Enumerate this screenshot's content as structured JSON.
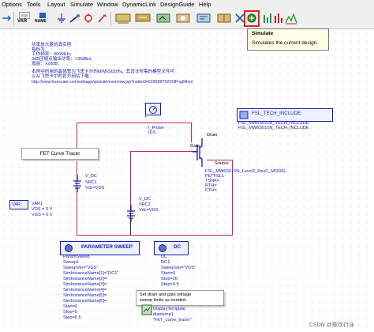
{
  "menu": [
    "Options",
    "Tools",
    "Layout",
    "Simulate",
    "Window",
    "DynamicLink",
    "DesignGuide",
    "Help"
  ],
  "toolbar_icons": [
    "arrow-icon",
    "var-icon",
    "name-icon",
    "wire-icon",
    "port-icon",
    "pin-icon",
    "tune-icon",
    "simulate-icon",
    "optimize-icon",
    "data-display-icon"
  ],
  "toolbar_text": {
    "var": "VAR",
    "name": "NAME"
  },
  "tooltip": {
    "title": "Simulate",
    "description": "Simulates the current design."
  },
  "notes": [
    "功率放大器仿真实例",
    "指标为：",
    "工作频率：900MHz;",
    "3dB压缩点输出功率：>35dBm;",
    "增益：>20dB;",
    "本例中所用的晶体管为飞思卡尔的MW6S010N，其设计所需的模型文件可",
    "以从飞思卡尔的官方网站下载：",
    "http://www.freescale.com/webapp/sps/site/overview.jsp?nodeId=0106B9752CNFng9Hnm"
  ],
  "probe": {
    "label": "I_Probe",
    "name": "IDS"
  },
  "fet_box": "FET Curve Tracer",
  "include": {
    "title": "FSL_TECH_INCLUDE",
    "line1": "FSL_MW6S010N_TECH_INCLUDE",
    "line2": "FSL_MW6S010N_TECH_INCLUDE"
  },
  "transistor": {
    "drain": "Drain",
    "gate": "Gate",
    "source": "Source",
    "model": "FSL_MW6S010N_Level2_RevC_MODEL",
    "lines": [
      "FETFSL1",
      "TSNK=",
      "RTH=",
      "CTH="
    ]
  },
  "src1": [
    "V_DC",
    "SRC1",
    "Vdc=VDS"
  ],
  "src2": [
    "V_DC",
    "SRC2",
    "Vdc=VGS"
  ],
  "var": {
    "title": "VAR",
    "lines": [
      "VAR1",
      "VDS = 0 V",
      "VGS = 0 V"
    ]
  },
  "sweep": {
    "title": "PARAMETER SWEEP",
    "lines": [
      "ParamSweep",
      "Sweep1",
      "SweepVar=\"VGS\"",
      "SimInstanceName[1]=\"DC1\"",
      "SimInstanceName[2]=",
      "SimInstanceName[3]=",
      "SimInstanceName[4]=",
      "SimInstanceName[5]=",
      "SimInstanceName[6]=",
      "Start=0",
      "Stop=5",
      "Step=0.5"
    ]
  },
  "dc": {
    "title": "DC",
    "lines": [
      "DC",
      "DC1",
      "SweepVar=\"VDS\"",
      "Start=0",
      "Stop=30",
      "Step=0.5"
    ]
  },
  "note2": [
    "Set drain and gate voltage",
    "sweep limits as needed."
  ],
  "display": [
    "DisplayTemplate",
    "disptemp1",
    "\"FET_curve_tracer\""
  ],
  "watermark": "CSDN @歌欢行泳"
}
